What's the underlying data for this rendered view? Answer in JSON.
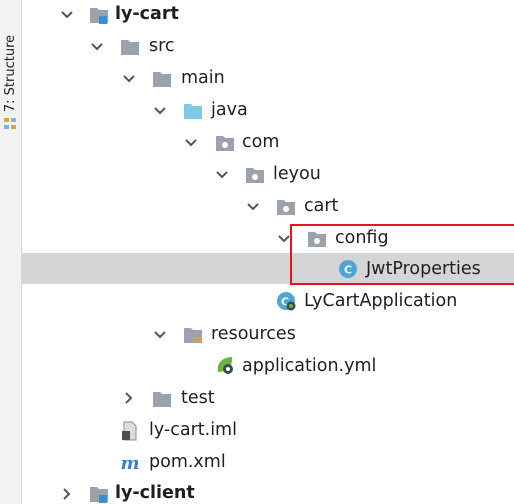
{
  "sidebar": {
    "structure_tab_label": "7: Structure"
  },
  "tree": {
    "ly_cart": "ly-cart",
    "src": "src",
    "main": "main",
    "java": "java",
    "com": "com",
    "leyou": "leyou",
    "cart": "cart",
    "config": "config",
    "jwt_properties": "JwtProperties",
    "ly_cart_application": "LyCartApplication",
    "resources": "resources",
    "application_yml": "application.yml",
    "test": "test",
    "ly_cart_iml": "ly-cart.iml",
    "pom_xml": "pom.xml",
    "ly_client": "ly-client"
  },
  "colors": {
    "selection": "#d5d5d5",
    "highlight_box": "#e8141e",
    "folder_gray": "#9aa3ad",
    "folder_blue": "#7ec8e8",
    "module_blue": "#3b8fd0",
    "class_icon": "#4ea6d6",
    "spring_green": "#6db33f",
    "maven": "#3a82c4"
  },
  "icons": {
    "module": "module-folder-icon",
    "folder": "folder-icon",
    "source_folder": "source-folder-icon",
    "package": "package-icon",
    "class": "class-icon",
    "spring_boot_class": "spring-boot-class-icon",
    "resources_folder": "resources-folder-icon",
    "spring_yml": "spring-config-icon",
    "iml": "iml-file-icon",
    "maven": "maven-icon"
  }
}
